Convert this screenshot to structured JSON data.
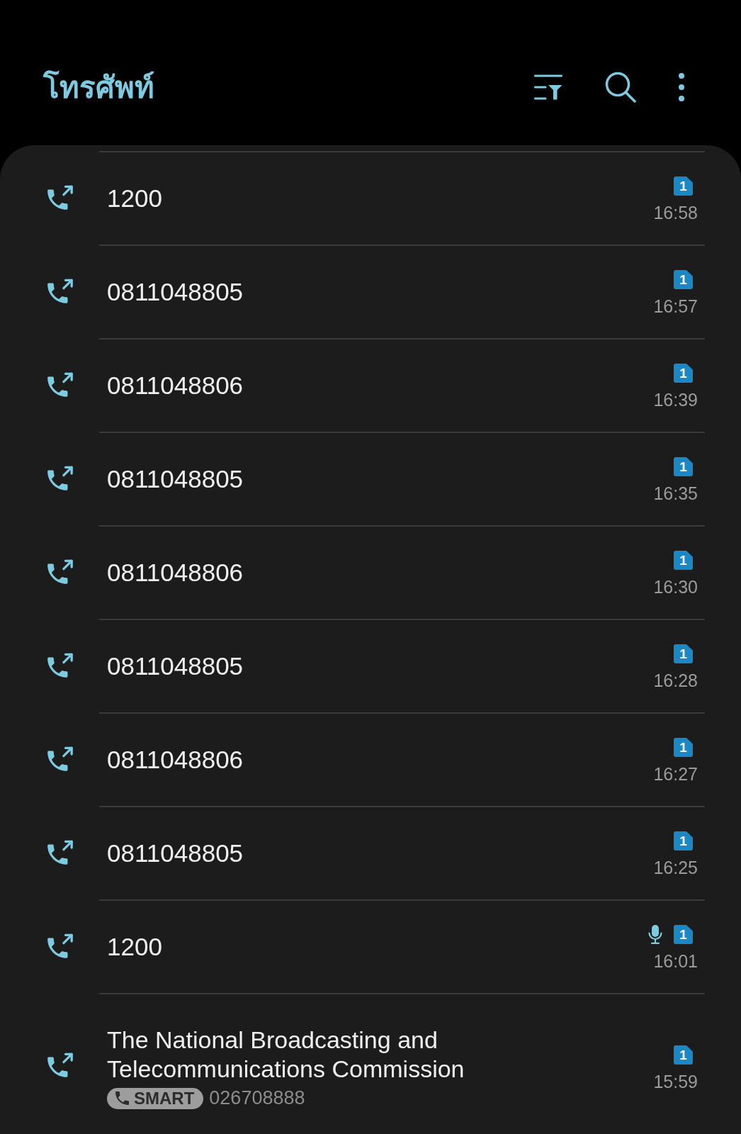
{
  "header": {
    "title": "โทรศัพท์"
  },
  "calls": [
    {
      "kind": "number",
      "number": "1200",
      "sim": "1",
      "time": "16:58",
      "recorded": false
    },
    {
      "kind": "number",
      "number": "0811048805",
      "sim": "1",
      "time": "16:57",
      "recorded": false
    },
    {
      "kind": "number",
      "number": "0811048806",
      "sim": "1",
      "time": "16:39",
      "recorded": false
    },
    {
      "kind": "number",
      "number": "0811048805",
      "sim": "1",
      "time": "16:35",
      "recorded": false
    },
    {
      "kind": "number",
      "number": "0811048806",
      "sim": "1",
      "time": "16:30",
      "recorded": false
    },
    {
      "kind": "number",
      "number": "0811048805",
      "sim": "1",
      "time": "16:28",
      "recorded": false
    },
    {
      "kind": "number",
      "number": "0811048806",
      "sim": "1",
      "time": "16:27",
      "recorded": false
    },
    {
      "kind": "number",
      "number": "0811048805",
      "sim": "1",
      "time": "16:25",
      "recorded": false
    },
    {
      "kind": "number",
      "number": "1200",
      "sim": "1",
      "time": "16:01",
      "recorded": true
    },
    {
      "kind": "contact",
      "name": "The National Broadcasting and Telecommunications Commission",
      "tag": "SMART",
      "number": "026708888",
      "sim": "1",
      "time": "15:59",
      "recorded": false
    }
  ]
}
